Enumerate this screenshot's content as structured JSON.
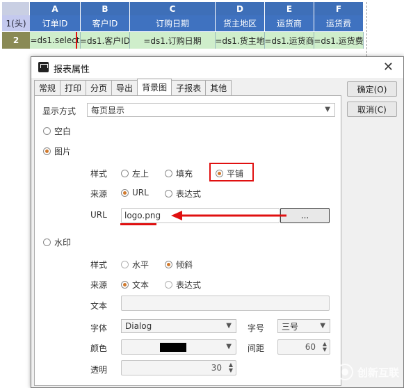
{
  "sheet": {
    "columns": [
      "A",
      "B",
      "C",
      "D",
      "E",
      "F"
    ],
    "row1_header": "1(头)",
    "row2_header": "2",
    "headers": [
      "订单ID",
      "客户ID",
      "订购日期",
      "货主地区",
      "运货商",
      "运货费"
    ],
    "values": [
      "=ds1.select",
      "=ds1.客户ID",
      "=ds1.订购日期",
      "=ds1.货主地",
      "=ds1.运货商",
      "=ds1.运货费"
    ]
  },
  "dialog": {
    "title": "报表属性",
    "tabs": [
      "常规",
      "打印",
      "分页",
      "导出",
      "背景图",
      "子报表",
      "其他"
    ],
    "ok_label": "确定(O)",
    "cancel_label": "取消(C)",
    "display_mode_label": "显示方式",
    "display_mode_value": "每页显示",
    "blank_label": "空白",
    "image_label": "图片",
    "style_label": "样式",
    "style_options": [
      "左上",
      "填充",
      "平铺"
    ],
    "source_label": "来源",
    "source_options": [
      "URL",
      "表达式"
    ],
    "url_label": "URL",
    "url_value": "logo.png",
    "browse_label": "...",
    "watermark_label": "水印",
    "wm_style_options": [
      "水平",
      "倾斜"
    ],
    "wm_source_options": [
      "文本",
      "表达式"
    ],
    "text_label": "文本",
    "font_label": "字体",
    "font_value": "Dialog",
    "size_label": "字号",
    "size_value": "三号",
    "color_label": "颜色",
    "color_value": "#000000",
    "spacing_label": "间距",
    "spacing_value": "60",
    "opacity_label": "透明",
    "opacity_value": "30"
  },
  "watermark_logo": "创新互联",
  "colors": {
    "header_blue": "#3f72c0",
    "cell_green": "#cfeecb",
    "highlight_red": "#e01010"
  }
}
